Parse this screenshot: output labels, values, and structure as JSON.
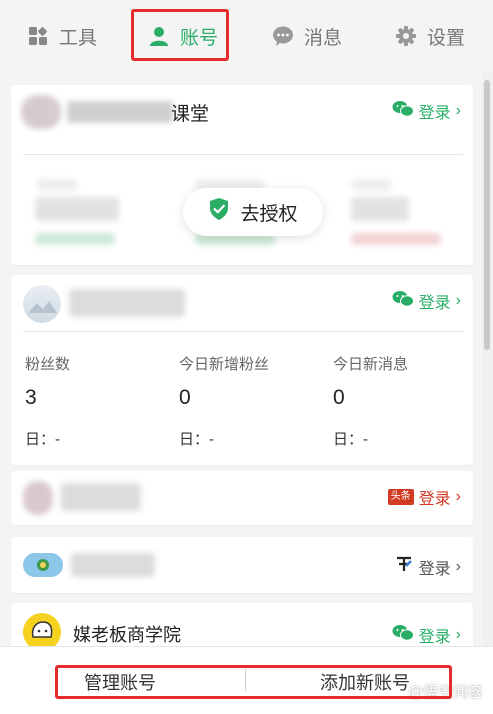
{
  "tabs": [
    {
      "label": "工具",
      "icon": "grid-icon"
    },
    {
      "label": "账号",
      "icon": "user-icon"
    },
    {
      "label": "消息",
      "icon": "chat-bubble-icon"
    },
    {
      "label": "设置",
      "icon": "gear-icon"
    }
  ],
  "active_tab": "账号",
  "accounts": [
    {
      "name_suffix": "课堂",
      "login_label": "登录",
      "platform_icon": "wechat-icon",
      "authorize_label": "去授权"
    },
    {
      "login_label": "登录",
      "platform_icon": "wechat-icon",
      "stats": [
        {
          "label": "粉丝数",
          "value": "3",
          "day": "日：-"
        },
        {
          "label": "今日新增粉丝",
          "value": "0",
          "day": "日：-"
        },
        {
          "label": "今日新消息",
          "value": "0",
          "day": "日：-"
        }
      ]
    },
    {
      "login_label": "登录",
      "platform_icon": "toutiao-icon",
      "platform_badge": "头条"
    },
    {
      "login_label": "登录",
      "platform_icon": "baijiahao-icon"
    },
    {
      "name": "媒老板商学院",
      "login_label": "登录",
      "platform_icon": "wechat-icon"
    }
  ],
  "bottom": {
    "manage_label": "管理账号",
    "add_label": "添加新账号",
    "watermark": "@悟空问答"
  },
  "colors": {
    "accent_green": "#2aae67",
    "highlight_red": "#e52b2b",
    "toutiao_red": "#d23a24"
  }
}
